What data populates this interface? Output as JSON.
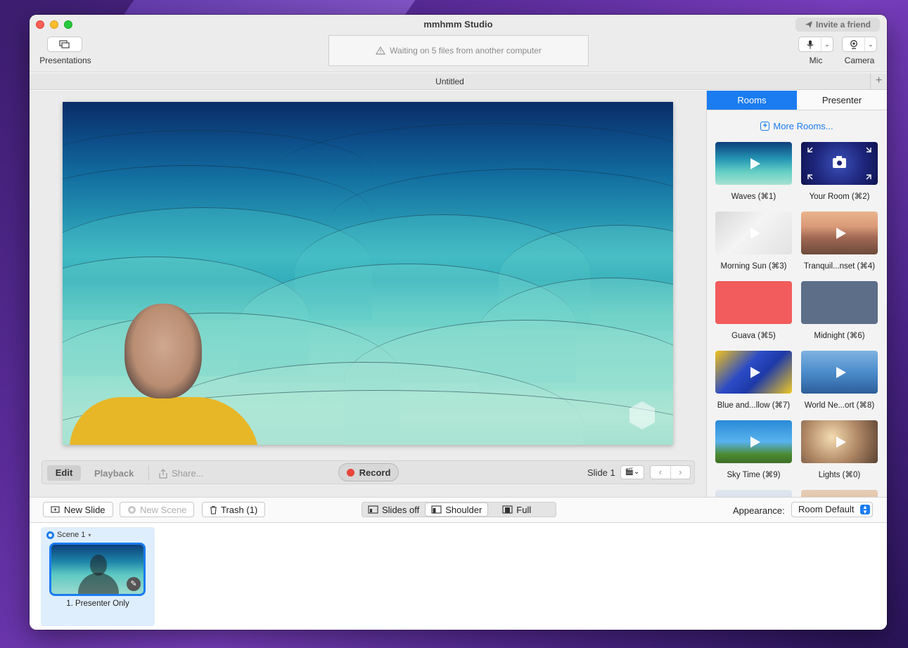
{
  "window": {
    "title": "mmhmm Studio",
    "invite_label": "Invite a friend"
  },
  "toolbar": {
    "presentations_label": "Presentations",
    "status_text": "Waiting on 5 files from another computer",
    "mic_label": "Mic",
    "camera_label": "Camera"
  },
  "tabbar": {
    "document_title": "Untitled",
    "add_label": "+"
  },
  "controls": {
    "edit_label": "Edit",
    "playback_label": "Playback",
    "share_label": "Share...",
    "record_label": "Record",
    "slide_label": "Slide 1",
    "prev_label": "‹",
    "next_label": "›"
  },
  "sidebar": {
    "tabs": [
      {
        "label": "Rooms",
        "active": true
      },
      {
        "label": "Presenter",
        "active": false
      }
    ],
    "more_rooms_label": "More Rooms...",
    "rooms": [
      {
        "label": "Waves (⌘1)",
        "thumb": "waves"
      },
      {
        "label": "Your Room (⌘2)",
        "thumb": "your-room"
      },
      {
        "label": "Morning Sun (⌘3)",
        "thumb": "morning-sun"
      },
      {
        "label": "Tranquil...nset (⌘4)",
        "thumb": "tranquil"
      },
      {
        "label": "Guava (⌘5)",
        "thumb": "guava",
        "color": "#f25c5c"
      },
      {
        "label": "Midnight (⌘6)",
        "thumb": "midnight",
        "color": "#5c6e88"
      },
      {
        "label": "Blue and...llow (⌘7)",
        "thumb": "blue-yellow"
      },
      {
        "label": "World Ne...ort (⌘8)",
        "thumb": "world-news"
      },
      {
        "label": "Sky Time (⌘9)",
        "thumb": "sky-time"
      },
      {
        "label": "Lights (⌘0)",
        "thumb": "lights"
      }
    ]
  },
  "bottombar": {
    "new_slide_label": "New Slide",
    "new_scene_label": "New Scene",
    "trash_label": "Trash (1)",
    "layout_options": [
      {
        "label": "Slides off",
        "active": false
      },
      {
        "label": "Shoulder",
        "active": true
      },
      {
        "label": "Full",
        "active": false
      }
    ],
    "appearance_label": "Appearance:",
    "appearance_value": "Room Default"
  },
  "scenes": {
    "scene_title": "Scene 1",
    "slides": [
      {
        "caption": "1. Presenter Only"
      }
    ]
  },
  "colors": {
    "accent": "#1a7cf0",
    "record": "#e8443a"
  }
}
